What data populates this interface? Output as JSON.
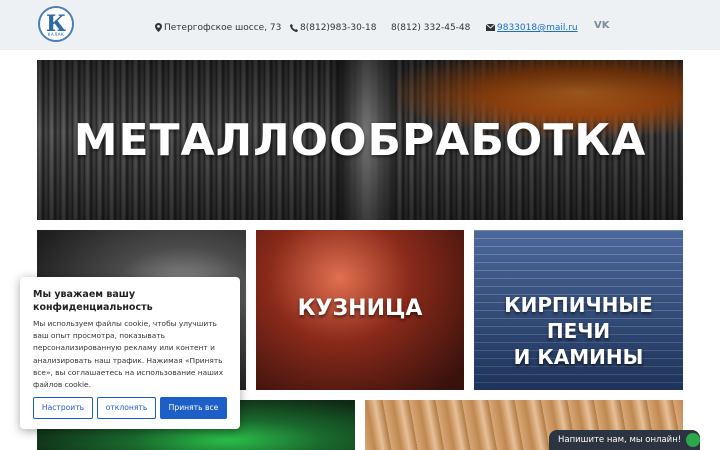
{
  "header": {
    "logo": {
      "letter": "К",
      "small_text": "КАЛАК"
    },
    "address": "Петергофское шоссе, 73",
    "phone1": "8(812)983-30-18",
    "phone2": "8(812) 332-45-48",
    "email": "9833018@mail.ru",
    "social_icon": "vk-icon",
    "icons": {
      "address": "map-marker-icon",
      "phone": "phone-icon",
      "email": "envelope-icon"
    }
  },
  "tiles": {
    "hero": {
      "title": "МЕТАЛЛООБРАБОТКА"
    },
    "forge": {
      "title": "КУЗНИЦА"
    },
    "stoves": {
      "title_line1": "КИРПИЧНЫЕ ПЕЧИ",
      "title_line2": "И КАМИНЫ"
    }
  },
  "cookie_banner": {
    "title": "Мы уважаем вашу конфиденциальность",
    "text": "Мы используем файлы cookie, чтобы улучшить ваш опыт просмотра, показывать персонализированную рекламу или контент и анализировать наш трафик. Нажимая «Принять все», вы соглашаетесь на использование наших файлов cookie.",
    "buttons": {
      "settings": "Настроить",
      "reject": "отклонять",
      "accept": "Принять все"
    },
    "accent_color": "#1c5fc7"
  },
  "chat_widget": {
    "label": "Напишите нам, мы онлайн!",
    "icon": "whatsapp-icon"
  }
}
